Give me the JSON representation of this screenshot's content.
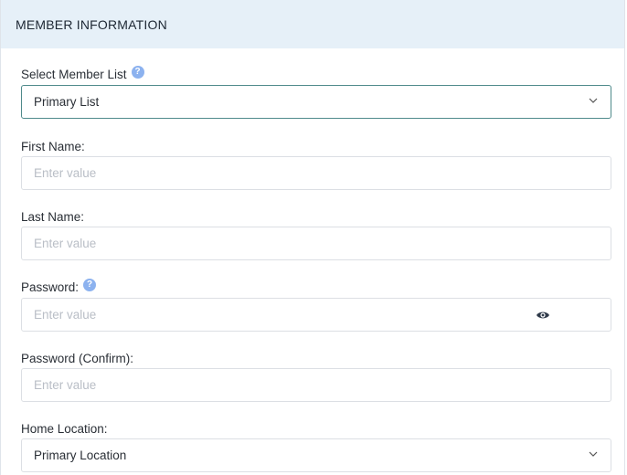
{
  "header": {
    "title": "MEMBER INFORMATION"
  },
  "member_list": {
    "label": "Select Member List",
    "selected": "Primary List",
    "help_icon": "?"
  },
  "first_name": {
    "label": "First Name:",
    "placeholder": "Enter value"
  },
  "last_name": {
    "label": "Last Name:",
    "placeholder": "Enter value"
  },
  "password": {
    "label": "Password:",
    "placeholder": "Enter value",
    "help_icon": "?",
    "toggle_icon": "eye-icon"
  },
  "password_confirm": {
    "label": "Password (Confirm):",
    "placeholder": "Enter value"
  },
  "home_location": {
    "label": "Home Location:",
    "selected": "Primary Location"
  },
  "colors": {
    "header_bg": "#e6f0f8",
    "help_icon": "#8cb2ef",
    "active_border": "#4f8a8b"
  }
}
